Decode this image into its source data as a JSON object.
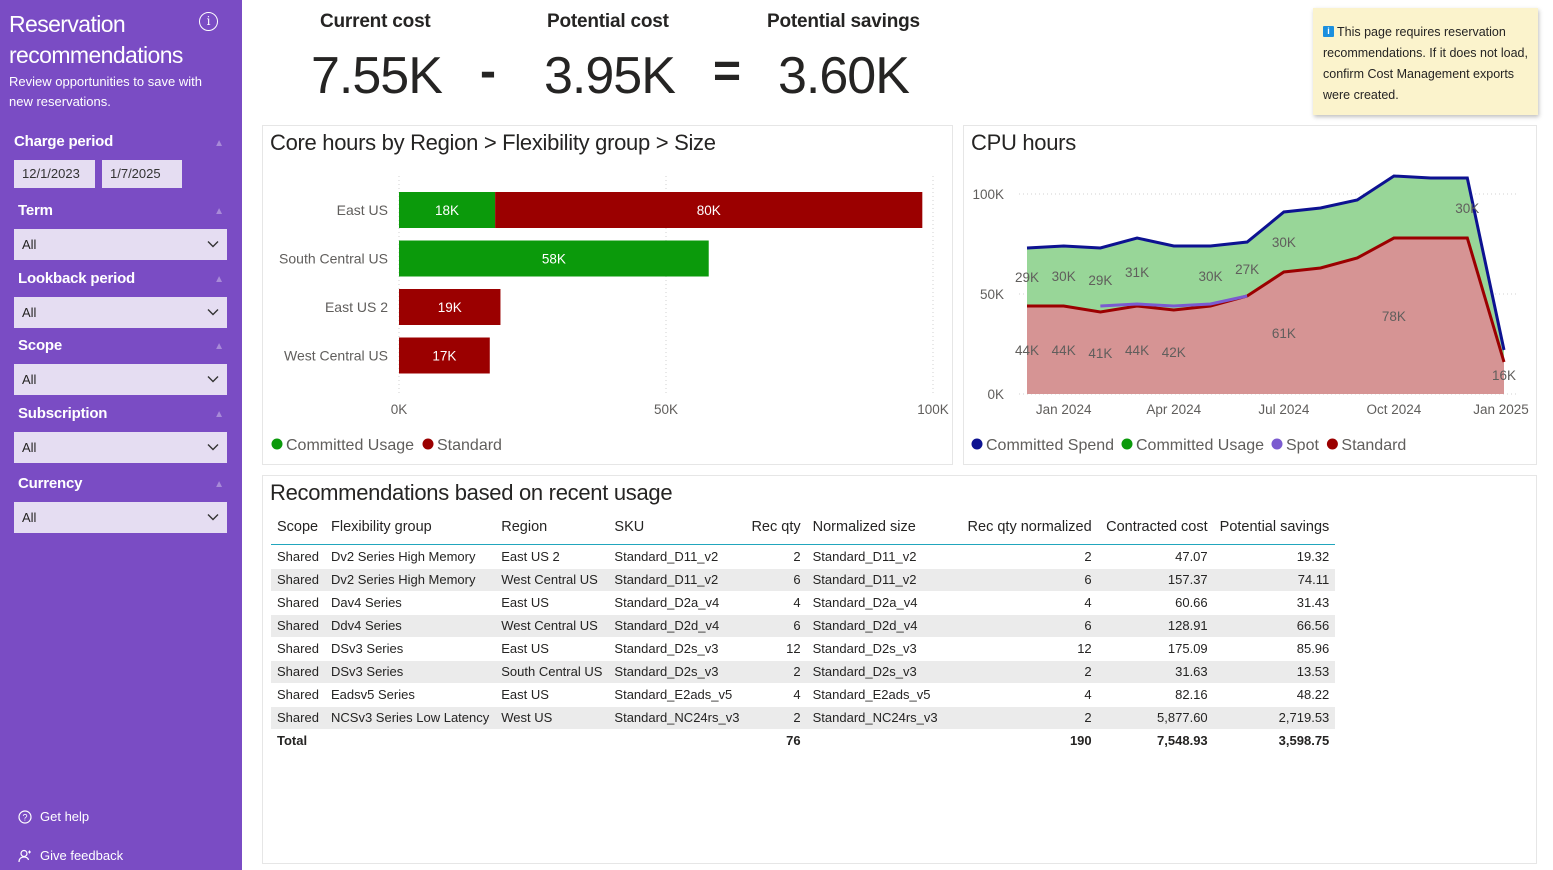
{
  "sidebar": {
    "title": "Reservation recommendations",
    "info_icon": "info-icon",
    "description": "Review opportunities to save with new reservations.",
    "filters": {
      "charge_period": {
        "label": "Charge period",
        "start": "12/1/2023",
        "end": "1/7/2025"
      },
      "term": {
        "label": "Term",
        "value": "All"
      },
      "lookback": {
        "label": "Lookback period",
        "value": "All"
      },
      "scope": {
        "label": "Scope",
        "value": "All"
      },
      "subscription": {
        "label": "Subscription",
        "value": "All"
      },
      "currency": {
        "label": "Currency",
        "value": "All"
      }
    },
    "links": {
      "help": "Get help",
      "feedback": "Give feedback"
    }
  },
  "kpis": {
    "current_label": "Current cost",
    "current_value": "7.55K",
    "minus": "-",
    "potential_label": "Potential cost",
    "potential_value": "3.95K",
    "equals": "=",
    "savings_label": "Potential savings",
    "savings_value": "3.60K"
  },
  "notice": {
    "text": "This page requires reservation recommendations. If it does not load, confirm Cost Management exports were created."
  },
  "colors": {
    "committed_usage": "#0b9a0b",
    "standard": "#9b0000",
    "committed_spend": "#0d1291",
    "spot": "#7b5bd0",
    "accent": "#7a4cc4"
  },
  "charts": {
    "core_hours": {
      "title": "Core hours by Region > Flexibility group > Size",
      "chart_data": {
        "type": "bar",
        "orientation": "horizontal",
        "stacked": true,
        "categories": [
          "East US",
          "South Central US",
          "East US 2",
          "West Central US"
        ],
        "series": [
          {
            "name": "Committed Usage",
            "values": [
              18000,
              58000,
              0,
              0
            ],
            "labels": [
              "18K",
              "58K",
              "",
              ""
            ]
          },
          {
            "name": "Standard",
            "values": [
              80000,
              0,
              19000,
              17000
            ],
            "labels": [
              "80K",
              "",
              "19K",
              "17K"
            ]
          }
        ],
        "xlim": [
          0,
          100000
        ],
        "x_ticks": [
          "0K",
          "50K",
          "100K"
        ],
        "legend": "bottom-left"
      }
    },
    "cpu_hours": {
      "title": "CPU hours",
      "chart_data": {
        "type": "area",
        "x": [
          "2023-12",
          "2024-01",
          "2024-02",
          "2024-03",
          "2024-04",
          "2024-05",
          "2024-06",
          "2024-07",
          "2024-08",
          "2024-09",
          "2024-10",
          "2024-11",
          "2024-12",
          "2025-01"
        ],
        "series": [
          {
            "name": "Committed Spend",
            "kind": "line",
            "values": [
              73000,
              74000,
              73000,
              78000,
              74000,
              74000,
              76000,
              91000,
              93000,
              97000,
              109000,
              108000,
              108000,
              22000
            ]
          },
          {
            "name": "Committed Usage",
            "kind": "area",
            "values": [
              29000,
              30000,
              29000,
              31000,
              null,
              30000,
              27000,
              30000,
              null,
              null,
              30000,
              null,
              30000,
              null
            ],
            "labels": [
              "29K",
              "30K",
              "29K",
              "31K",
              "",
              "30K",
              "27K",
              "30K",
              "",
              "",
              "",
              "",
              "30K",
              ""
            ]
          },
          {
            "name": "Spot",
            "kind": "line",
            "values": [
              null,
              null,
              44000,
              45000,
              44000,
              45000,
              49000,
              null,
              null,
              null,
              null,
              null,
              null,
              null
            ]
          },
          {
            "name": "Standard",
            "kind": "area",
            "values": [
              44000,
              44000,
              41000,
              44000,
              42000,
              44000,
              49000,
              61000,
              63000,
              68000,
              78000,
              78000,
              78000,
              16000
            ],
            "labels": [
              "44K",
              "44K",
              "41K",
              "44K",
              "42K",
              "",
              "",
              "61K",
              "",
              "",
              "78K",
              "",
              "",
              "16K"
            ]
          }
        ],
        "ylim": [
          0,
          120000
        ],
        "y_ticks": [
          "0K",
          "50K",
          "100K"
        ],
        "x_ticks": [
          "Jan 2024",
          "Apr 2024",
          "Jul 2024",
          "Oct 2024",
          "Jan 2025"
        ],
        "legend": "bottom-left"
      }
    }
  },
  "recommendations": {
    "title": "Recommendations based on recent usage",
    "columns": [
      "Scope",
      "Flexibility group",
      "Region",
      "SKU",
      "Rec qty",
      "Normalized size",
      "Rec qty normalized",
      "Contracted cost",
      "Potential savings"
    ],
    "rows": [
      [
        "Shared",
        "Dv2 Series High Memory",
        "East US 2",
        "Standard_D11_v2",
        "2",
        "Standard_D11_v2",
        "2",
        "47.07",
        "19.32"
      ],
      [
        "Shared",
        "Dv2 Series High Memory",
        "West Central US",
        "Standard_D11_v2",
        "6",
        "Standard_D11_v2",
        "6",
        "157.37",
        "74.11"
      ],
      [
        "Shared",
        "Dav4 Series",
        "East US",
        "Standard_D2a_v4",
        "4",
        "Standard_D2a_v4",
        "4",
        "60.66",
        "31.43"
      ],
      [
        "Shared",
        "Ddv4 Series",
        "West Central US",
        "Standard_D2d_v4",
        "6",
        "Standard_D2d_v4",
        "6",
        "128.91",
        "66.56"
      ],
      [
        "Shared",
        "DSv3 Series",
        "East US",
        "Standard_D2s_v3",
        "12",
        "Standard_D2s_v3",
        "12",
        "175.09",
        "85.96"
      ],
      [
        "Shared",
        "DSv3 Series",
        "South Central US",
        "Standard_D2s_v3",
        "2",
        "Standard_D2s_v3",
        "2",
        "31.63",
        "13.53"
      ],
      [
        "Shared",
        "Eadsv5 Series",
        "East US",
        "Standard_E2ads_v5",
        "4",
        "Standard_E2ads_v5",
        "4",
        "82.16",
        "48.22"
      ],
      [
        "Shared",
        "NCSv3 Series Low Latency",
        "West US",
        "Standard_NC24rs_v3",
        "2",
        "Standard_NC24rs_v3",
        "2",
        "5,877.60",
        "2,719.53"
      ]
    ],
    "total": [
      "Total",
      "",
      "",
      "",
      "76",
      "",
      "190",
      "7,548.93",
      "3,598.75"
    ]
  }
}
